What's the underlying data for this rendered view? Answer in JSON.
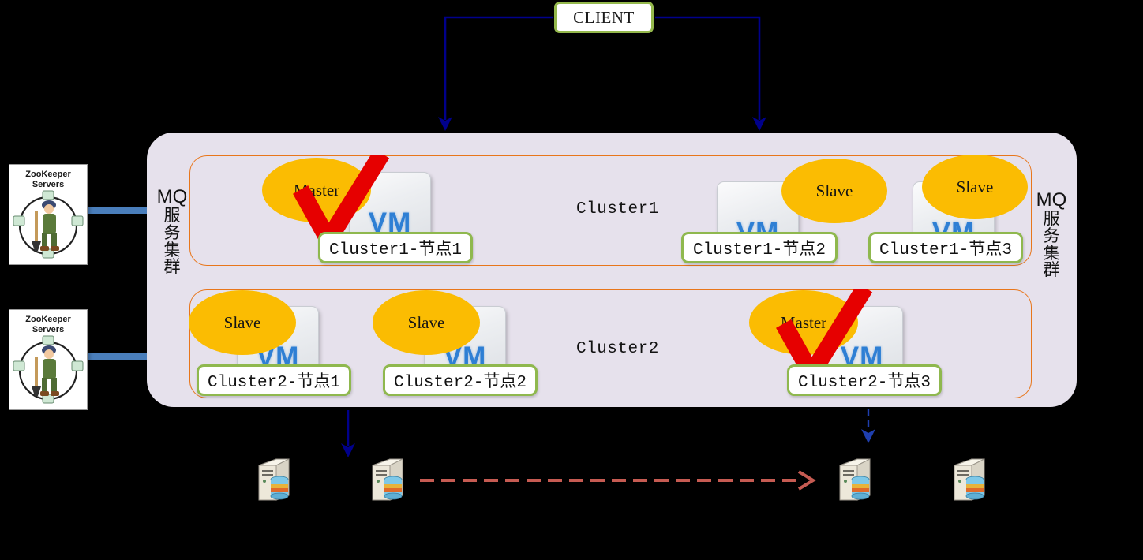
{
  "diagram": {
    "client": {
      "label": "CLIENT"
    },
    "left_rail": {
      "mq_label": "MQ",
      "cjk_chars": [
        "服",
        "务",
        "集",
        "群"
      ]
    },
    "right_rail": {
      "mq_label": "MQ",
      "cjk_chars": [
        "服",
        "务",
        "集",
        "群"
      ]
    },
    "zookeeper": {
      "line1": "ZooKeeper",
      "line2": "Servers",
      "instances": [
        "zookeeper-servers-top",
        "zookeeper-servers-bottom"
      ]
    },
    "clusters": [
      {
        "title": "Cluster1",
        "nodes": [
          {
            "role": "Master",
            "label": "Cluster1-节点1",
            "icon": "vm-icon",
            "checked": true
          },
          {
            "role": "Slave",
            "label": "Cluster1-节点2",
            "icon": "vm-icon",
            "checked": false
          },
          {
            "role": "Slave",
            "label": "Cluster1-节点3",
            "icon": "vm-icon",
            "checked": false
          }
        ]
      },
      {
        "title": "Cluster2",
        "nodes": [
          {
            "role": "Slave",
            "label": "Cluster2-节点1",
            "icon": "vm-icon",
            "checked": false
          },
          {
            "role": "Slave",
            "label": "Cluster2-节点2",
            "icon": "vm-icon",
            "checked": false
          },
          {
            "role": "Master",
            "label": "Cluster2-节点3",
            "icon": "vm-icon",
            "checked": true
          }
        ]
      }
    ],
    "bottom_servers": [
      {
        "name": "database-server-1"
      },
      {
        "name": "database-server-2"
      },
      {
        "name": "database-server-3"
      },
      {
        "name": "database-server-4"
      }
    ],
    "vm_icon_text": "VM",
    "colors": {
      "background": "#000000",
      "container_fill": "#E6E1EC",
      "cluster_border": "#E8761B",
      "role_ellipse": "#FBBC02",
      "node_label_border": "#8FB84E",
      "client_border": "#94B84C",
      "client_arrow": "#00008B",
      "zookeeper_arrow": "#4A7EBB",
      "replication_arrow": "#C65B52",
      "check_mark": "#E60000",
      "vm_text": "#2E7FD4"
    }
  }
}
